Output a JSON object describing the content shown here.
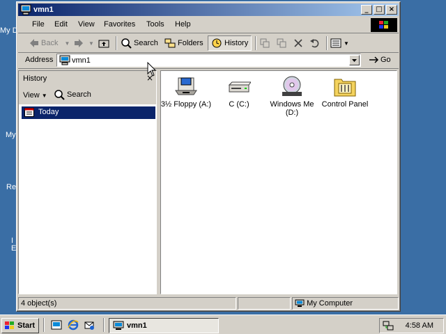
{
  "desktop": {
    "labels": [
      "My D",
      "My",
      "Re",
      "I",
      "E"
    ]
  },
  "window": {
    "title": "vmn1",
    "menu": [
      "File",
      "Edit",
      "View",
      "Favorites",
      "Tools",
      "Help"
    ],
    "toolbar": {
      "back": "Back",
      "search": "Search",
      "folders": "Folders",
      "history": "History"
    },
    "address": {
      "label": "Address",
      "value": "vmn1",
      "go": "Go"
    },
    "history_pane": {
      "title": "History",
      "view": "View",
      "search": "Search",
      "today": "Today"
    },
    "files": [
      {
        "icon": "floppy-drive-icon",
        "label": "3½ Floppy (A:)"
      },
      {
        "icon": "hard-drive-icon",
        "label": "C (C:)"
      },
      {
        "icon": "cd-drive-icon",
        "label": "Windows Me (D:)"
      },
      {
        "icon": "control-panel-icon",
        "label": "Control Panel"
      }
    ],
    "status": {
      "objects": "4 object(s)",
      "zone": "My Computer"
    }
  },
  "taskbar": {
    "start": "Start",
    "task": "vmn1",
    "clock": "4:58 AM"
  },
  "colors": {
    "desktop": "#3a6ea5",
    "title_active": "#0a246a",
    "face": "#d4d0c8"
  }
}
